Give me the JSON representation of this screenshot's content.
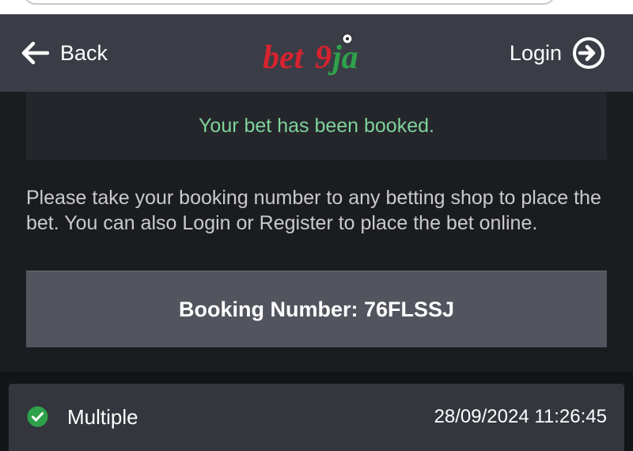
{
  "header": {
    "back_label": "Back",
    "login_label": "Login",
    "logo": {
      "text_bet": "bet",
      "text_9": "9",
      "text_ja": "ja",
      "colors": {
        "bet": "#d7232f",
        "nine": "#d7232f",
        "ja": "#2ea24a"
      }
    }
  },
  "notice": {
    "message": "Your bet has been booked.",
    "color": "#7ed39b"
  },
  "info": {
    "text": "Please take your booking number to any betting shop to place the bet. You can also Login or Register to place the bet online."
  },
  "booking": {
    "label": "Booking Number: 76FLSSJ"
  },
  "bet": {
    "status_icon": "check-circle-icon",
    "status_color": "#2ea24a",
    "type": "Multiple",
    "datetime": "28/09/2024 11:26:45"
  },
  "icons": {
    "back": "arrow-left-icon",
    "login": "arrow-right-circle-icon"
  }
}
